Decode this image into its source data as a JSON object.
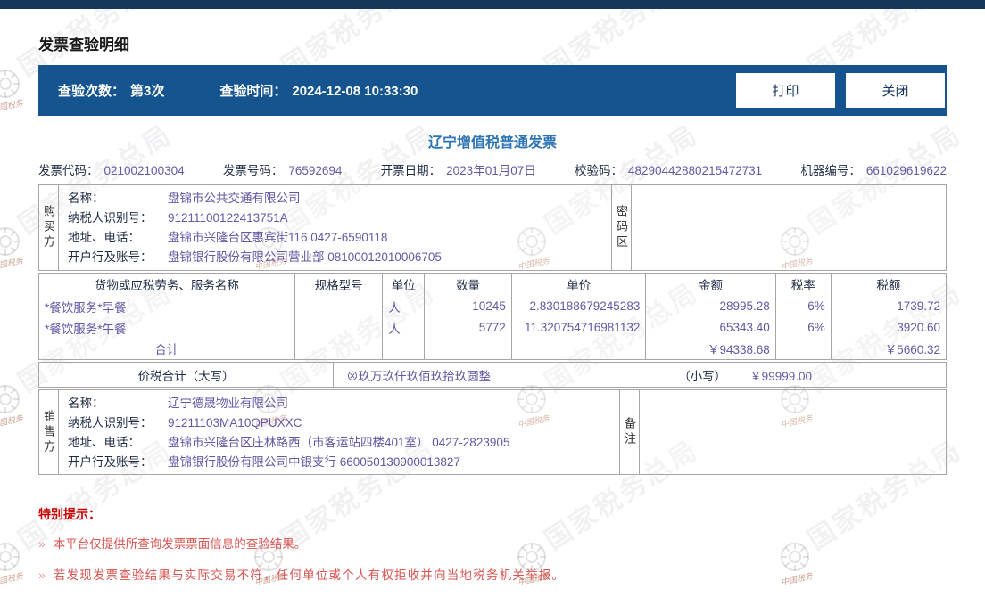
{
  "watermark": {
    "text": "国家税务总局",
    "script": "中国税务"
  },
  "page_title": "发票查验明细",
  "toolbar": {
    "count_label": "查验次数：",
    "count_value": "第3次",
    "time_label": "查验时间：",
    "time_value": "2024-12-08 10:33:30",
    "print": "打印",
    "close": "关闭"
  },
  "invoice": {
    "title": "辽宁增值税普通发票",
    "meta": [
      {
        "label": "发票代码：",
        "value": "021002100304"
      },
      {
        "label": "发票号码：",
        "value": "76592694"
      },
      {
        "label": "开票日期：",
        "value": "2023年01月07日"
      },
      {
        "label": "校验码：",
        "value": "48290442880215472731"
      },
      {
        "label": "机器编号：",
        "value": "661029619622"
      }
    ],
    "buyer": {
      "side_label": "购买方",
      "rows": [
        {
          "label": "名称：",
          "value": "盘锦市公共交通有限公司"
        },
        {
          "label": "纳税人识别号：",
          "value": "91211100122413751A"
        },
        {
          "label": "地址、电话：",
          "value": "盘锦市兴隆台区惠宾街116 0427-6590118"
        },
        {
          "label": "开户行及账号：",
          "value": "盘锦银行股份有限公司营业部 08100012010006705"
        }
      ],
      "password_label": "密码区",
      "password_value": ""
    },
    "items_table": {
      "headers": [
        "货物或应税劳务、服务名称",
        "规格型号",
        "单位",
        "数量",
        "单价",
        "金额",
        "税率",
        "税额"
      ],
      "rows": [
        {
          "name": "*餐饮服务*早餐",
          "spec": "",
          "unit": "人",
          "qty": "10245",
          "price": "2.830188679245283",
          "amount": "28995.28",
          "rate": "6%",
          "tax": "1739.72"
        },
        {
          "name": "*餐饮服务*午餐",
          "spec": "",
          "unit": "人",
          "qty": "5772",
          "price": "11.320754716981132",
          "amount": "65343.40",
          "rate": "6%",
          "tax": "3920.60"
        }
      ],
      "total_label": "合计",
      "total_amount": "￥94338.68",
      "total_tax": "￥5660.32"
    },
    "tax_total": {
      "label": "价税合计（大写）",
      "uppercase": "⊗玖万玖仟玖佰玖拾玖圆整",
      "small_label": "（小写）",
      "amount": "￥99999.00"
    },
    "seller": {
      "side_label": "销售方",
      "rows": [
        {
          "label": "名称：",
          "value": "辽宁德晟物业有限公司"
        },
        {
          "label": "纳税人识别号：",
          "value": "91211103MA10QPUXXC"
        },
        {
          "label": "地址、电话：",
          "value": "盘锦市兴隆台区庄林路西（市客运站四楼401室） 0427-2823905"
        },
        {
          "label": "开户行及账号：",
          "value": "盘锦银行股份有限公司中银支行 660050130900013827"
        }
      ],
      "remark_label": "备注",
      "remark_value": ""
    }
  },
  "notice": {
    "title": "特别提示：",
    "bullet_marker": "»",
    "bullets": [
      "本平台仅提供所查询发票票面信息的查验结果。",
      "若发现发票查验结果与实际交易不符，任何单位或个人有权拒收并向当地税务机关举报。"
    ]
  },
  "colors": {
    "top_bar": "#16365c",
    "toolbar_blue": "#15548e",
    "invoice_title_blue": "#2e74b5",
    "value_purple": "#6458a5",
    "label_navy": "#1f2b44",
    "alert_red": "#cc0000",
    "border_gray": "#a6a6a6"
  }
}
